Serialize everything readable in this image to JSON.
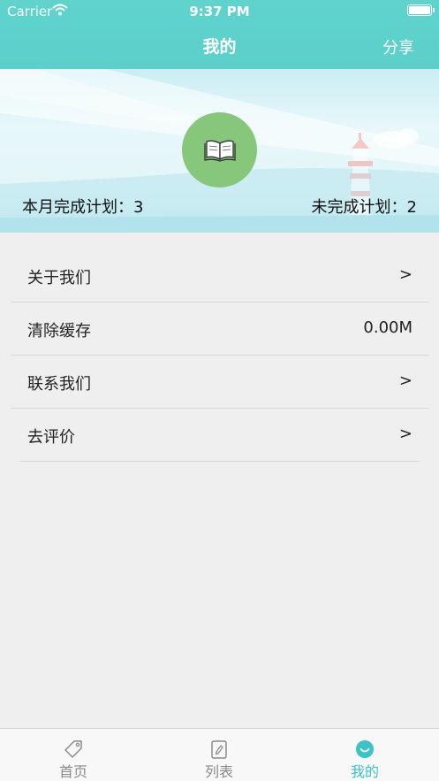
{
  "status_bar": {
    "carrier": "Carrier",
    "time": "9:37 PM"
  },
  "nav": {
    "title": "我的",
    "share_label": "分享"
  },
  "profile": {
    "completed_plans_label": "本月完成计划：3",
    "uncompleted_plans_label": "未完成计划：2"
  },
  "menu": {
    "items": [
      {
        "label": "关于我们",
        "value": ">"
      },
      {
        "label": "清除缓存",
        "value": "0.00M"
      },
      {
        "label": "联系我们",
        "value": ">"
      },
      {
        "label": "去评价",
        "value": ">"
      }
    ]
  },
  "tabbar": {
    "tabs": [
      {
        "label": "首页",
        "icon": "tag-icon",
        "active": false
      },
      {
        "label": "列表",
        "icon": "note-icon",
        "active": false
      },
      {
        "label": "我的",
        "icon": "smile-icon",
        "active": true
      }
    ]
  },
  "colors": {
    "header": "#5fd3cc",
    "avatar": "#86c77c",
    "active_tab": "#3cc3c6",
    "inactive_tab": "#8a8a8a",
    "background": "#efefef"
  }
}
